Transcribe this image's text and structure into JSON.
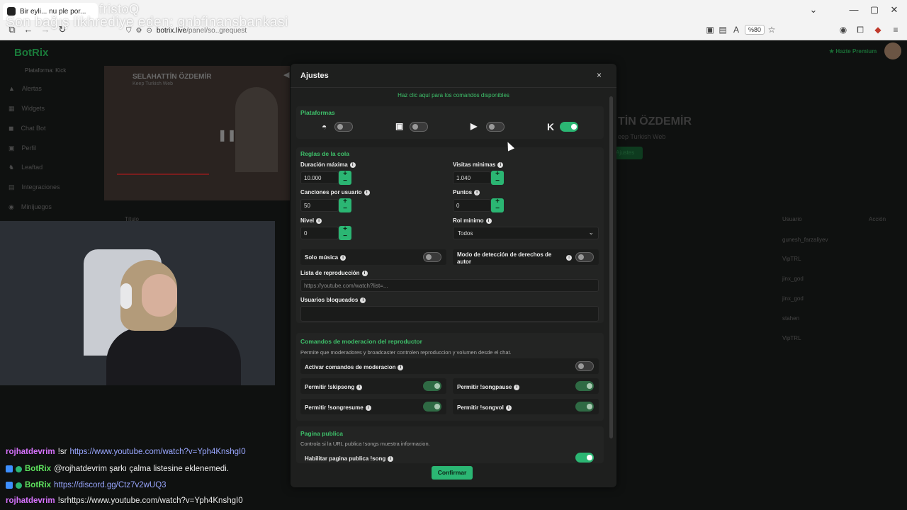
{
  "browser": {
    "tab_title": "Bir eyli... nu ple por...",
    "overlay_line1": "fristoQ",
    "overlay_line2": "Son bağış likhrediye eden: gnbfinansbankasi",
    "url_host": "botrix.live",
    "url_path": "/panel/so..grequest",
    "zoom": "%80"
  },
  "app": {
    "logo": "BotRix",
    "platform": "Plataforma: Kick",
    "sidebar": [
      "Alertas",
      "Widgets",
      "Chat Bot",
      "Perfil",
      "Leaftad",
      "Integraciones",
      "Minijuegos"
    ],
    "bg_title": "TİN ÖZDEMİR",
    "bg_sub": "eep Turkish Web",
    "bg_btn": "Ajustes",
    "premium": "Hazte Premium",
    "video_name": "SELAHATTİN ÖZDEMİR",
    "video_sub": "Keep Turkish Web",
    "col_user": "Usuario",
    "col_action": "Acción",
    "col_title": "Título",
    "users": [
      "gunesh_farzaliyev",
      "VipTRL",
      "jinx_god",
      "jinx_god",
      "stahen",
      "VipTRL"
    ]
  },
  "modal": {
    "title": "Ajustes",
    "close": "×",
    "commands_link": "Haz clic aquí para los comandos disponibles",
    "platforms_title": "Plataformas",
    "queue_title": "Reglas de la cola",
    "max_duration_label": "Duración máxima",
    "max_duration_value": "10.000",
    "min_views_label": "Visitas mínimas",
    "min_views_value": "1.040",
    "songs_per_user_label": "Canciones por usuario",
    "songs_per_user_value": "50",
    "points_label": "Puntos",
    "points_value": "0",
    "level_label": "Nivel",
    "level_value": "0",
    "min_role_label": "Rol mínimo",
    "min_role_value": "Todos",
    "music_only_label": "Solo música",
    "copyright_label": "Modo de detección de derechos de autor",
    "playlist_label": "Lista de reproducción",
    "playlist_placeholder": "https://youtube.com/watch?list=...",
    "blocked_label": "Usuarios bloqueados",
    "mod_title": "Comandos de moderacion del reproductor",
    "mod_desc": "Permite que moderadores y broadcaster controlen reproduccion y volumen desde el chat.",
    "mod_enable_label": "Activar comandos de moderacion",
    "allow_skip": "Permitir !skipsong",
    "allow_pause": "Permitir !songpause",
    "allow_resume": "Permitir !songresume",
    "allow_vol": "Permitir !songvol",
    "public_title": "Pagina publica",
    "public_desc": "Controla si la URL publica !songs muestra informacion.",
    "public_enable_label": "Habilitar pagina publica !song",
    "confirm": "Confirmar"
  },
  "chat": [
    {
      "user": "rojhatdevrim",
      "color": "#d873ff",
      "text": "!sr ",
      "link": "https://www.youtube.com/watch?v=Yph4KnshgI0"
    },
    {
      "user": "BotRix",
      "color": "#5ee35e",
      "text": "@rojhatdevrim şarkı çalma listesine eklenemedi.",
      "link": ""
    },
    {
      "user": "BotRix",
      "color": "#5ee35e",
      "text": "",
      "link": "https://discord.gg/Ctz7v2wUQ3"
    },
    {
      "user": "rojhatdevrim",
      "color": "#d873ff",
      "text": "!srhttps://www.youtube.com/watch?v=Yph4KnshgI0",
      "link": ""
    }
  ]
}
